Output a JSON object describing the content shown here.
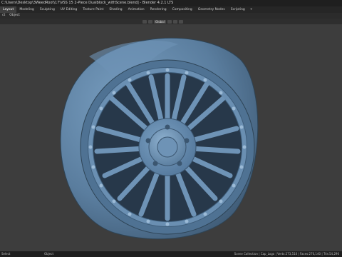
{
  "window": {
    "title": "C:\\Users\\Desktop\\3WeedRoot\\17\\VSS 15 2-Piece Dualblock_withScene.blend] - Blender 4.2.1 LTS"
  },
  "workspace_tabs": [
    "Layout",
    "Modeling",
    "Sculpting",
    "UV Editing",
    "Texture Paint",
    "Shading",
    "Animation",
    "Rendering",
    "Compositing",
    "Geometry Nodes",
    "Scripting"
  ],
  "tab_add_label": "+",
  "scene_selector": {
    "value": "Scene"
  },
  "menu": [
    "ct",
    "Object"
  ],
  "viewport_header": {
    "orientation": "Global"
  },
  "status": {
    "left": "Select",
    "mid": "Object",
    "right": "Scene Collection | Cap_Logo | Verts:273,510 | Faces:270,140 | Tris:54,290"
  },
  "colors": {
    "viewport_bg": "#3d3d3d",
    "wheel_base": "#5a7d9e",
    "wheel_highlight": "#7aa0c2",
    "wheel_shadow": "#3b5670",
    "active_tab": "#3f3f3f"
  },
  "icons": [
    "scene-icon",
    "tool-icon"
  ]
}
